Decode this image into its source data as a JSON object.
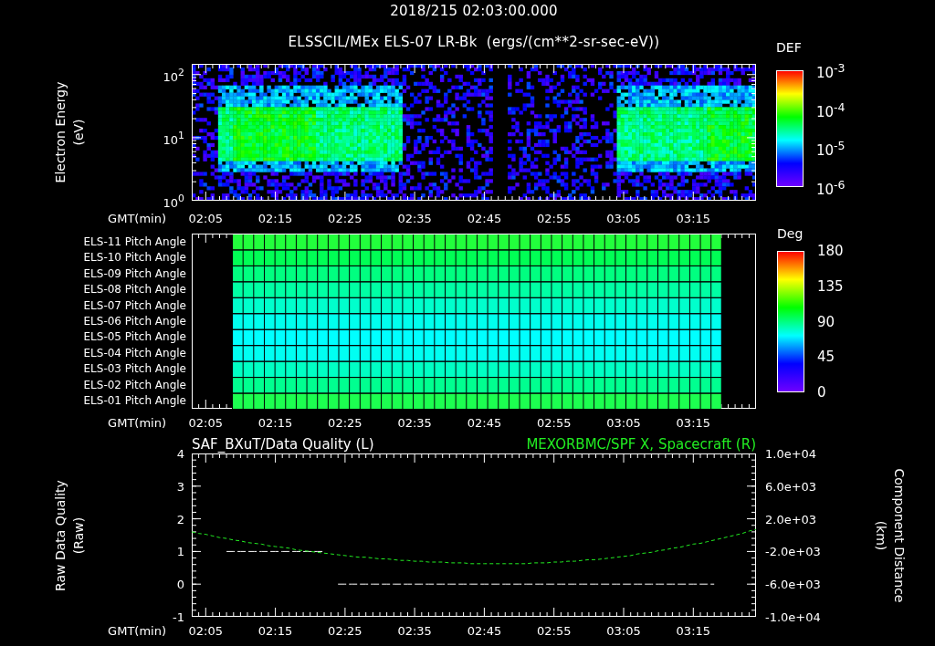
{
  "energy_panel": {
    "date": "2018/215 02:03:00.000",
    "title": "ELSSCIL/MEx ELS-07 LR-Bk  (ergs/(cm**2-sr-sec-eV))",
    "ylabel": [
      "Electron Energy",
      "(eV)"
    ],
    "y_ticks": [
      "10$^{2}$",
      "10$^{1}$",
      "10$^{0}$"
    ],
    "colorbar": {
      "title": "DEF",
      "labels": [
        "10$^{-3}$",
        "10$^{-4}$",
        "10$^{-5}$",
        "10$^{-6}$"
      ]
    },
    "x_axis": {
      "label": "GMT(min)",
      "ticks": [
        "02:05",
        "02:15",
        "02:25",
        "02:35",
        "02:45",
        "02:55",
        "03:05",
        "03:15"
      ]
    }
  },
  "pitch_panel": {
    "rows": [
      {
        "label": "ELS-11 Pitch Angle",
        "color": "#22ff3c"
      },
      {
        "label": "ELS-10 Pitch Angle",
        "color": "#00ff55"
      },
      {
        "label": "ELS-09 Pitch Angle",
        "color": "#00ff80"
      },
      {
        "label": "ELS-08 Pitch Angle",
        "color": "#00ffa4"
      },
      {
        "label": "ELS-07 Pitch Angle",
        "color": "#00ffcc"
      },
      {
        "label": "ELS-06 Pitch Angle",
        "color": "#00ffee"
      },
      {
        "label": "ELS-05 Pitch Angle",
        "color": "#00ffff"
      },
      {
        "label": "ELS-04 Pitch Angle",
        "color": "#00fff2"
      },
      {
        "label": "ELS-03 Pitch Angle",
        "color": "#00ffc4"
      },
      {
        "label": "ELS-02 Pitch Angle",
        "color": "#00ff90"
      },
      {
        "label": "ELS-01 Pitch Angle",
        "color": "#1cff50"
      }
    ],
    "colorbar": {
      "title": "Deg",
      "labels": [
        "180",
        "135",
        "90",
        "45",
        "0"
      ]
    },
    "x_axis": {
      "label": "GMT(min)",
      "ticks": [
        "02:05",
        "02:15",
        "02:25",
        "02:35",
        "02:45",
        "02:55",
        "03:05",
        "03:15"
      ]
    }
  },
  "quality_panel": {
    "ylabel": [
      "Raw Data Quality",
      "(Raw)"
    ],
    "chart_data": {
      "type": "line",
      "xlabel": "GMT(min)",
      "y2label": "Component Distance (km)",
      "categories": [
        null,
        null,
        "02:05",
        null,
        null,
        null,
        null,
        null,
        null,
        null,
        null,
        null,
        "02:15",
        null,
        null,
        null,
        null,
        null,
        null,
        null,
        null,
        null,
        "02:25",
        null,
        null,
        null,
        null,
        null,
        null,
        null,
        null,
        null,
        "02:35",
        null,
        null,
        null,
        null,
        null,
        null,
        null,
        null,
        null,
        "02:45",
        null,
        null,
        null,
        null,
        null,
        null,
        null,
        null,
        null,
        "02:55",
        null,
        null,
        null,
        null,
        null,
        null,
        null,
        null,
        null,
        "03:05",
        null,
        null,
        null,
        null,
        null,
        null,
        null,
        null,
        null,
        "03:15",
        null,
        null,
        null,
        null,
        null,
        null,
        null,
        null,
        null
      ],
      "ylim": [
        -1,
        4
      ],
      "yticks": [
        4,
        3,
        2,
        1,
        0,
        -1
      ],
      "y2lim": [
        -10000,
        10000
      ],
      "y2ticks": [
        {
          "value": 10000,
          "label": "1.0e+04"
        },
        {
          "value": 6000,
          "label": "6.0e+03"
        },
        {
          "value": 2000,
          "label": "2.0e+03"
        },
        {
          "value": -2000,
          "label": "-2.0e+03"
        },
        {
          "value": -6000,
          "label": "-6.0e+03"
        },
        {
          "value": -10000,
          "label": "-1.0e+04"
        }
      ],
      "series": [
        {
          "name": "SAF_BXuT/Data Quality (L)",
          "color": "#ffffff",
          "line_style": "dashed",
          "values": [
            null,
            null,
            null,
            null,
            null,
            1,
            1,
            1,
            1,
            1,
            1,
            1,
            1,
            1,
            1,
            1,
            1,
            1,
            1,
            1,
            null,
            0,
            0,
            0,
            0,
            0,
            0,
            0,
            0,
            0,
            0,
            0,
            0,
            0,
            0,
            0,
            0,
            0,
            0,
            0,
            0,
            0,
            0,
            0,
            0,
            0,
            0,
            0,
            0,
            0,
            0,
            0,
            0,
            0,
            0,
            0,
            0,
            0,
            0,
            0,
            0,
            0,
            0,
            0,
            0,
            0,
            0,
            0,
            0,
            0,
            0,
            0,
            0,
            0,
            0,
            0,
            null,
            null,
            null,
            null,
            null,
            null
          ]
        },
        {
          "name": "MEXORBMC/SPF X, Spacecraft (R)",
          "color": "#22ee22",
          "axis": "y2",
          "line_style": "dashed",
          "values": [
            400,
            200,
            100,
            -100,
            -300,
            -400,
            -600,
            -700,
            -900,
            -1000,
            -1100,
            -1300,
            -1400,
            -1500,
            -1600,
            -1800,
            -1900,
            -2000,
            -2100,
            -2200,
            -2300,
            -2400,
            -2500,
            -2600,
            -2700,
            -2700,
            -2800,
            -2900,
            -2900,
            -3000,
            -3100,
            -3100,
            -3200,
            -3200,
            -3300,
            -3300,
            -3300,
            -3400,
            -3400,
            -3400,
            -3500,
            -3500,
            -3500,
            -3500,
            -3500,
            -3500,
            -3500,
            -3500,
            -3500,
            -3400,
            -3400,
            -3400,
            -3300,
            -3300,
            -3200,
            -3200,
            -3100,
            -3000,
            -3000,
            -2900,
            -2800,
            -2700,
            -2600,
            -2500,
            -2300,
            -2200,
            -2100,
            -1900,
            -1800,
            -1600,
            -1500,
            -1300,
            -1100,
            -1000,
            -800,
            -600,
            -400,
            -200,
            0,
            200,
            500,
            700
          ]
        }
      ]
    }
  }
}
